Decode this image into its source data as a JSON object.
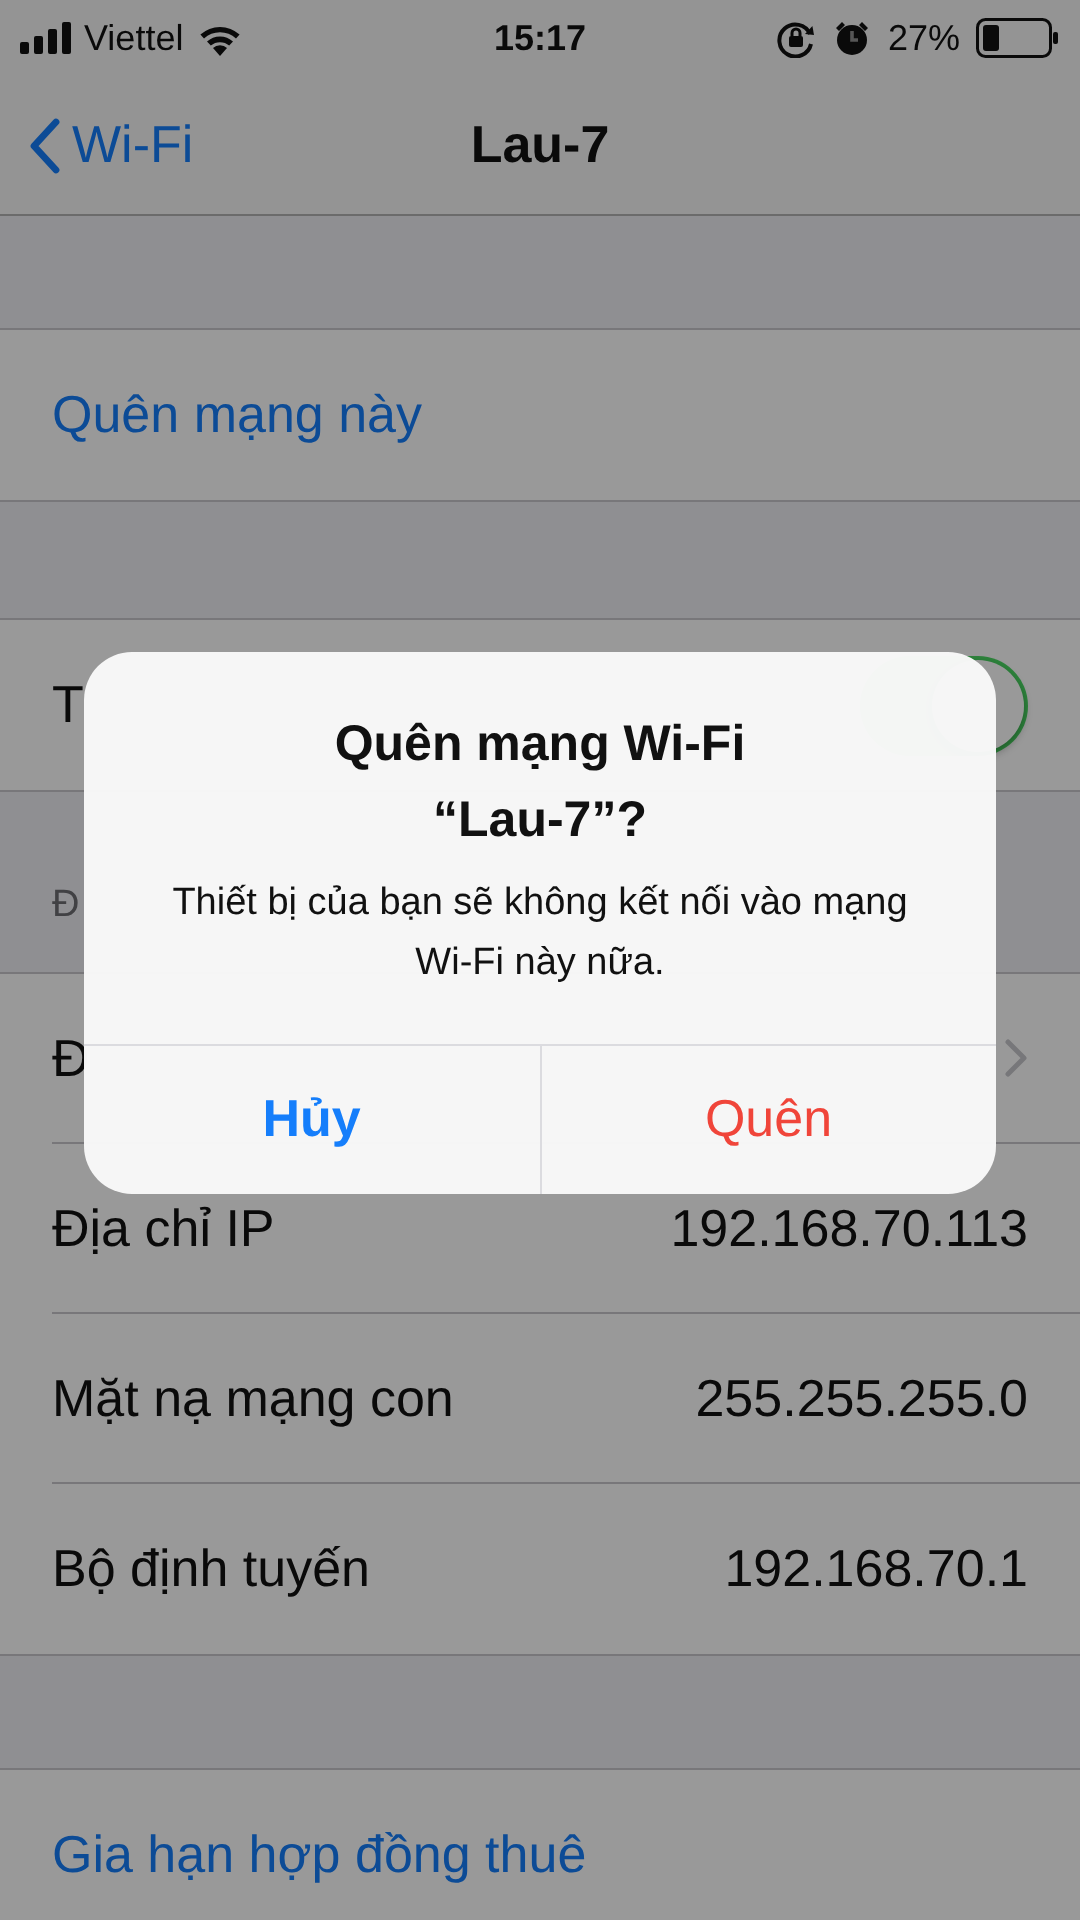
{
  "status_bar": {
    "carrier": "Viettel",
    "time": "15:17",
    "battery": "27%"
  },
  "nav": {
    "back": "Wi-Fi",
    "title": "Lau-7"
  },
  "sections": [
    {
      "rows": [
        {
          "kind": "action",
          "label": "Quên mạng này"
        }
      ]
    },
    {
      "rows": [
        {
          "kind": "toggle",
          "label": "T",
          "on": true
        }
      ]
    },
    {
      "header": "Đ",
      "rows": [
        {
          "kind": "disclosure",
          "label": "Đ"
        },
        {
          "kind": "value",
          "label": "Địa chỉ IP",
          "value": "192.168.70.113"
        },
        {
          "kind": "value",
          "label": "Mặt nạ mạng con",
          "value": "255.255.255.0"
        },
        {
          "kind": "value",
          "label": "Bộ định tuyến",
          "value": "192.168.70.1"
        }
      ]
    },
    {
      "rows": [
        {
          "kind": "action",
          "label": "Gia hạn hợp đồng thuê"
        }
      ]
    }
  ],
  "alert": {
    "title": "Quên mạng Wi-Fi “Lau-7”?",
    "message": "Thiết bị của bạn sẽ không kết nối vào mạng Wi-Fi này nữa.",
    "buttons": [
      {
        "kind": "cancel",
        "label": "Hủy"
      },
      {
        "kind": "destructive",
        "label": "Quên"
      }
    ]
  }
}
